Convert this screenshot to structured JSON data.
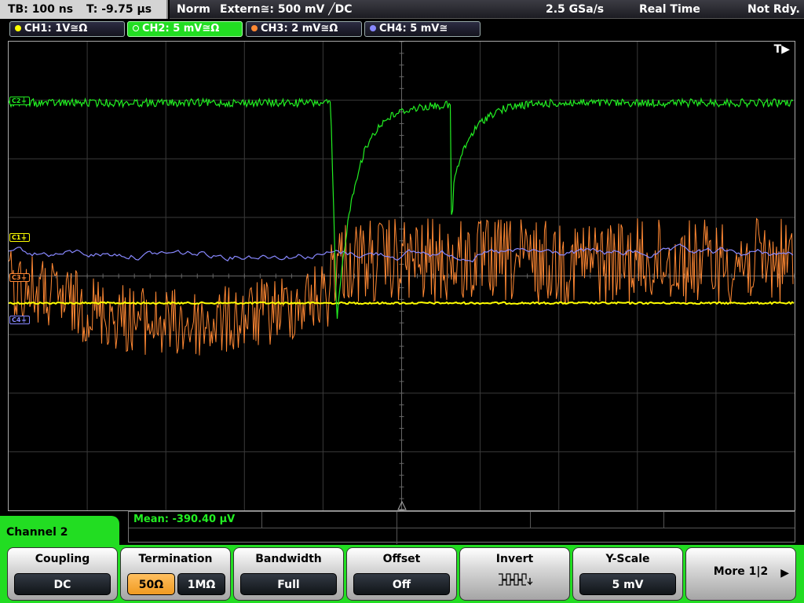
{
  "topbar": {
    "timebase": "TB: 100 ns",
    "trigger_time": "T: -9.75 µs",
    "mode": "Norm",
    "trigger": "Extern≅: 500 mV ╱DC",
    "sample_rate": "2.5 GSa/s",
    "acq_mode": "Real Time",
    "status": "Not Rdy."
  },
  "channels": [
    {
      "label": "CH1: 1V≅Ω",
      "color": "#ffff00"
    },
    {
      "label": "CH2: 5 mV≅Ω",
      "color": "#22ee22"
    },
    {
      "label": "CH3: 2 mV≅Ω",
      "color": "#ff8833"
    },
    {
      "label": "CH4: 5 mV≅",
      "color": "#8888ff"
    }
  ],
  "screen": {
    "trigger_indicator": "T▶",
    "markers": {
      "c2": "C2⏚",
      "c1": "C1⏚",
      "c3": "C3⏚",
      "c4": "C4⏚"
    }
  },
  "measurement": {
    "label": "Mean: -390.40 µV"
  },
  "menu": {
    "channel_label": "Channel 2",
    "coupling": {
      "title": "Coupling",
      "value": "DC"
    },
    "termination": {
      "title": "Termination",
      "opt1": "50Ω",
      "opt2": "1MΩ"
    },
    "bandwidth": {
      "title": "Bandwidth",
      "value": "Full"
    },
    "offset": {
      "title": "Offset",
      "value": "Off"
    },
    "invert": {
      "title": "Invert",
      "icon": "invert-waveform-icon"
    },
    "yscale": {
      "title": "Y-Scale",
      "value": "5 mV"
    },
    "more": {
      "label": "More 1|2",
      "icon": "arrow-right-icon"
    }
  }
}
